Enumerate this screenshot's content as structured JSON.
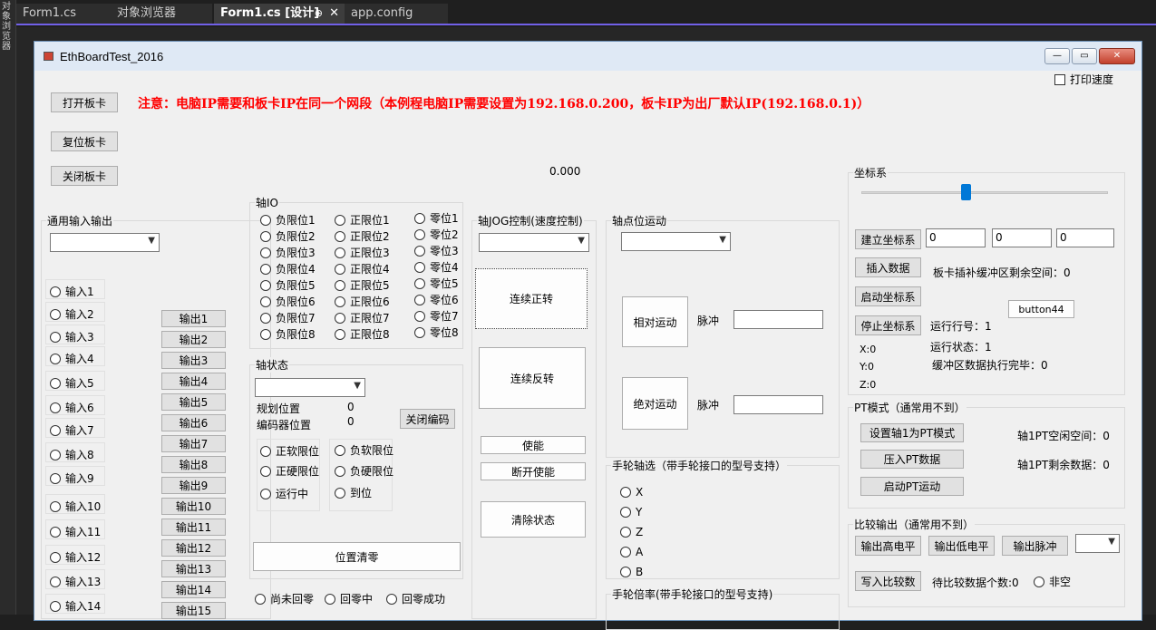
{
  "ide": {
    "left_strip": "对象浏览器",
    "tabs": [
      {
        "label": "Form1.cs"
      },
      {
        "label": "对象浏览器"
      },
      {
        "label": "Form1.cs [设计]",
        "pin": "⊕",
        "close": "✕"
      },
      {
        "label": "app.config"
      }
    ]
  },
  "form": {
    "title": "EthBoardTest_2016",
    "window_buttons": {
      "minimize": "—",
      "maximize": "▭",
      "close": "✕"
    },
    "print_speed_label": "打印速度",
    "notice": "注意：电脑IP需要和板卡IP在同一个网段（本例程电脑IP需要设置为192.168.0.200，板卡IP为出厂默认IP(192.168.0.1)）",
    "open_card": "打开板卡",
    "reset_card": "复位板卡",
    "close_card": "关闭板卡",
    "value_display": "0.000"
  },
  "io": {
    "title": "通用输入输出",
    "inputs": [
      "输入1",
      "输入2",
      "输入3",
      "输入4",
      "输入5",
      "输入6",
      "输入7",
      "输入8",
      "输入9",
      "输入10",
      "输入11",
      "输入12",
      "输入13",
      "输入14"
    ],
    "outputs": [
      "输出1",
      "输出2",
      "输出3",
      "输出4",
      "输出5",
      "输出6",
      "输出7",
      "输出8",
      "输出9",
      "输出10",
      "输出11",
      "输出12",
      "输出13",
      "输出14",
      "输出15"
    ]
  },
  "axis_io": {
    "title": "轴IO",
    "neg_limits": [
      "负限位1",
      "负限位2",
      "负限位3",
      "负限位4",
      "负限位5",
      "负限位6",
      "负限位7",
      "负限位8"
    ],
    "pos_limits": [
      "正限位1",
      "正限位2",
      "正限位3",
      "正限位4",
      "正限位5",
      "正限位6",
      "正限位7",
      "正限位8"
    ],
    "zeros": [
      "零位1",
      "零位2",
      "零位3",
      "零位4",
      "零位5",
      "零位6",
      "零位7",
      "零位8"
    ]
  },
  "axis_status": {
    "title": "轴状态",
    "plan_pos_label": "规划位置",
    "plan_pos_value": "0",
    "enc_pos_label": "编码器位置",
    "enc_pos_value": "0",
    "close_encoder": "关闭编码",
    "flags": [
      "正软限位",
      "负软限位",
      "正硬限位",
      "负硬限位",
      "运行中",
      "到位"
    ],
    "zero_pos": "位置清零"
  },
  "homing": [
    "尚未回零",
    "回零中",
    "回零成功"
  ],
  "jog": {
    "title": "轴JOG控制(速度控制)",
    "forward": "连续正转",
    "reverse": "连续反转",
    "enable": "使能",
    "disable": "断开使能",
    "clear": "清除状态"
  },
  "point_motion": {
    "title": "轴点位运动",
    "relative": "相对运动",
    "absolute": "绝对运动",
    "pulse1": "脉冲",
    "pulse2": "脉冲"
  },
  "handwheel_axis": {
    "title": "手轮轴选（带手轮接口的型号支持）",
    "options": [
      "X",
      "Y",
      "Z",
      "A",
      "B"
    ]
  },
  "handwheel_ratio": {
    "title": "手轮倍率(带手轮接口的型号支持)"
  },
  "coord": {
    "title": "坐标系",
    "slider_level": 0.42,
    "build": "建立坐标系",
    "insert": "插入数据",
    "start": "启动坐标系",
    "stop": "停止坐标系",
    "inputs": [
      "0",
      "0",
      "0"
    ],
    "buffer_label": "板卡插补缓冲区剩余空间：0",
    "button44": "button44",
    "run_line": "运行行号：1",
    "run_state": "运行状态：1",
    "buffer_done": "缓冲区数据执行完毕：0",
    "x": "X:0",
    "y": "Y:0",
    "z": "Z:0"
  },
  "pt": {
    "title": "PT模式（通常用不到）",
    "set_pt": "设置轴1为PT模式",
    "push_pt": "压入PT数据",
    "start_pt": "启动PT运动",
    "free_space": "轴1PT空闲空间：0",
    "remain": "轴1PT剩余数据：0"
  },
  "compare": {
    "title": "比较输出（通常用不到）",
    "high": "输出高电平",
    "low": "输出低电平",
    "pulse": "输出脉冲",
    "write": "写入比较数",
    "pending": "待比较数据个数:0",
    "not_empty": "非空"
  }
}
